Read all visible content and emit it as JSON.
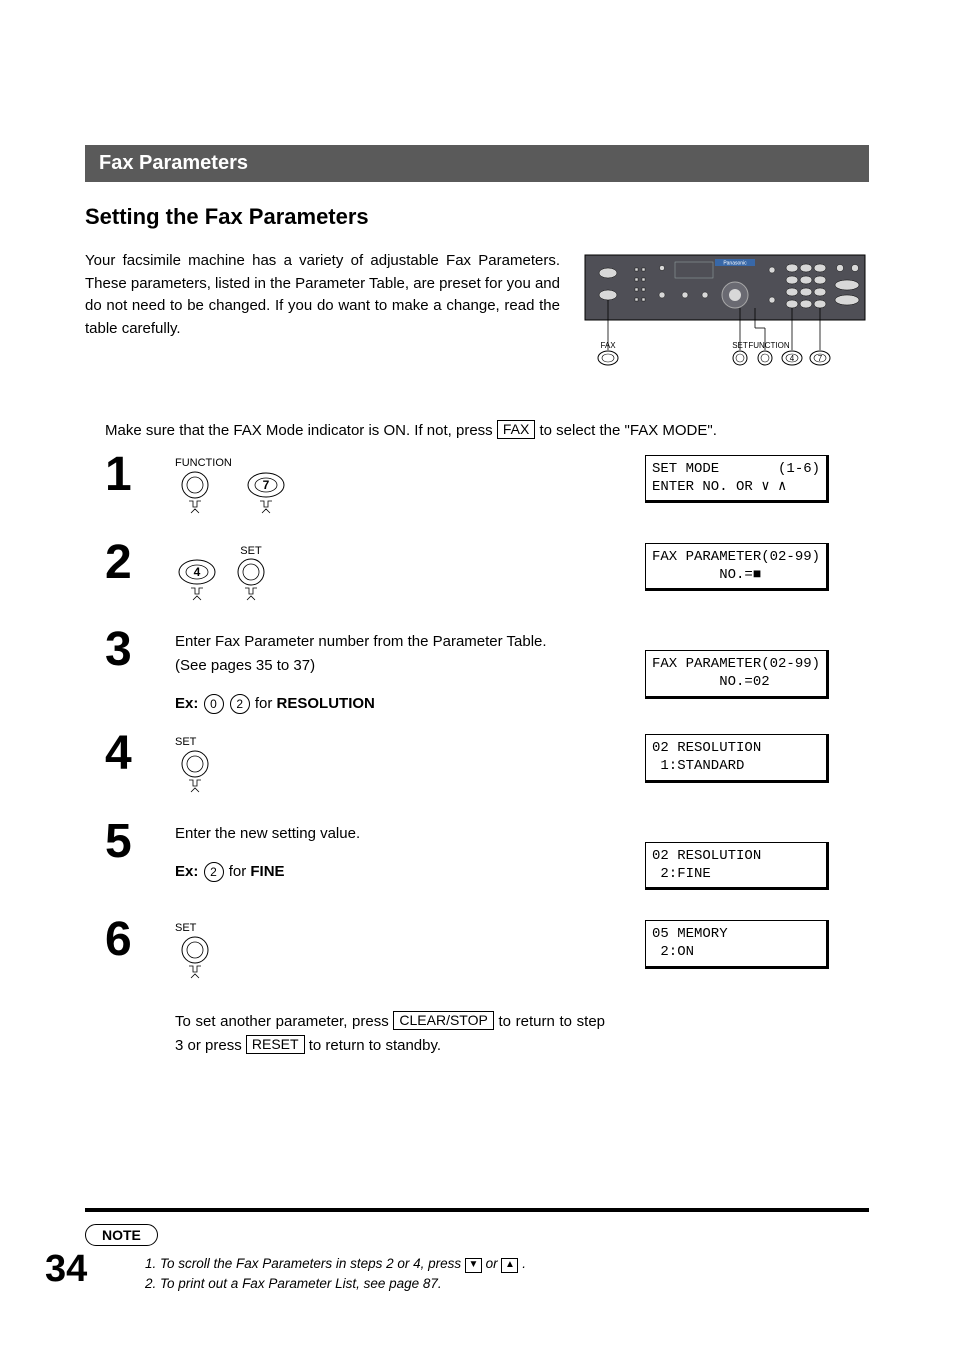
{
  "header": "Fax Parameters",
  "subheading": "Setting the Fax Parameters",
  "intro": "Your facsimile machine has a variety of adjustable Fax Parameters.  These parameters, listed in the Parameter Table, are preset for you and do not need to be changed.  If you do want to make a change, read the table carefully.",
  "diagram_labels": {
    "fax": "FAX",
    "set": "SET",
    "function": "FUNCTION",
    "four": "4",
    "seven": "7",
    "brand": "Panasonic"
  },
  "pre_instruct": {
    "a": "Make sure that the FAX Mode indicator is ON.  If not, press ",
    "fax_btn": "FAX",
    "b": " to select the \"FAX MODE\"."
  },
  "steps": [
    {
      "num": "1",
      "label_a": "FUNCTION",
      "key_b": "7",
      "display": "SET MODE       (1-6)\nENTER NO. OR ∨ ∧"
    },
    {
      "num": "2",
      "key_a": "4",
      "label_b": "SET",
      "display": "FAX PARAMETER(02-99)\n        NO.=■"
    },
    {
      "num": "3",
      "text_a": "Enter Fax Parameter number from the Parameter Table.",
      "text_b": "(See pages 35 to 37)",
      "ex_prefix": "Ex:",
      "ex_keys": [
        "0",
        "2"
      ],
      "ex_suffix_a": " for ",
      "ex_bold": "RESOLUTION",
      "display": "FAX PARAMETER(02-99)\n        NO.=02"
    },
    {
      "num": "4",
      "label_a": "SET",
      "display": "02 RESOLUTION\n 1:STANDARD"
    },
    {
      "num": "5",
      "text_a": "Enter the new setting value.",
      "ex_prefix": "Ex:",
      "ex_keys": [
        "2"
      ],
      "ex_suffix_a": " for ",
      "ex_bold": "FINE",
      "display": "02 RESOLUTION\n 2:FINE"
    },
    {
      "num": "6",
      "label_a": "SET",
      "display": "05 MEMORY\n 2:ON",
      "tail_a": "To set another parameter, press ",
      "tail_btn1": "CLEAR/STOP",
      "tail_b": " to return to step 3 or press ",
      "tail_btn2": "RESET",
      "tail_c": " to return to standby."
    }
  ],
  "note_label": "NOTE",
  "notes": {
    "n1a": "1. To scroll the Fax Parameters in steps 2 or 4, press ",
    "n1b": " or ",
    "n1c": ".",
    "n2": "2. To print out a Fax Parameter List, see page 87."
  },
  "page_number": "34"
}
